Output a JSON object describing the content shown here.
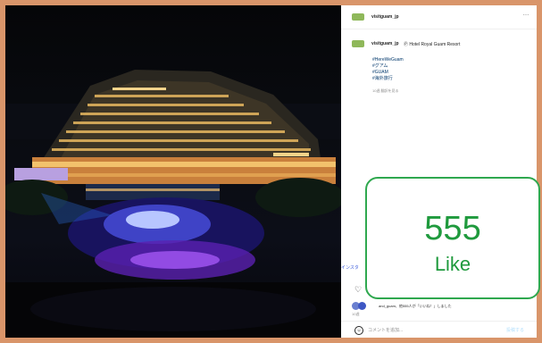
{
  "post": {
    "username": "visitguam_jp",
    "location": "Ⓟ Hotel Royal Guam Resort",
    "hashtags": [
      "#HereWeGuam",
      "#グアム",
      "#GUAM",
      "#海外旅行"
    ],
    "meta": "10週  翻訳を見る",
    "insta_label": "インスタ",
    "likes_text": "and_guam、他555人が「いいね！」しました",
    "likes_time": "10週",
    "comment_placeholder": "コメントを追加...",
    "post_label": "投稿する",
    "more_icon": "…",
    "smile_icon": "☺",
    "heart_icon": "♡"
  },
  "overlay": {
    "count": "555",
    "label": "Like",
    "color": "#1f9a3d"
  },
  "colors": {
    "frame_border": "#d9956a",
    "photo_bg": "#06070c"
  }
}
